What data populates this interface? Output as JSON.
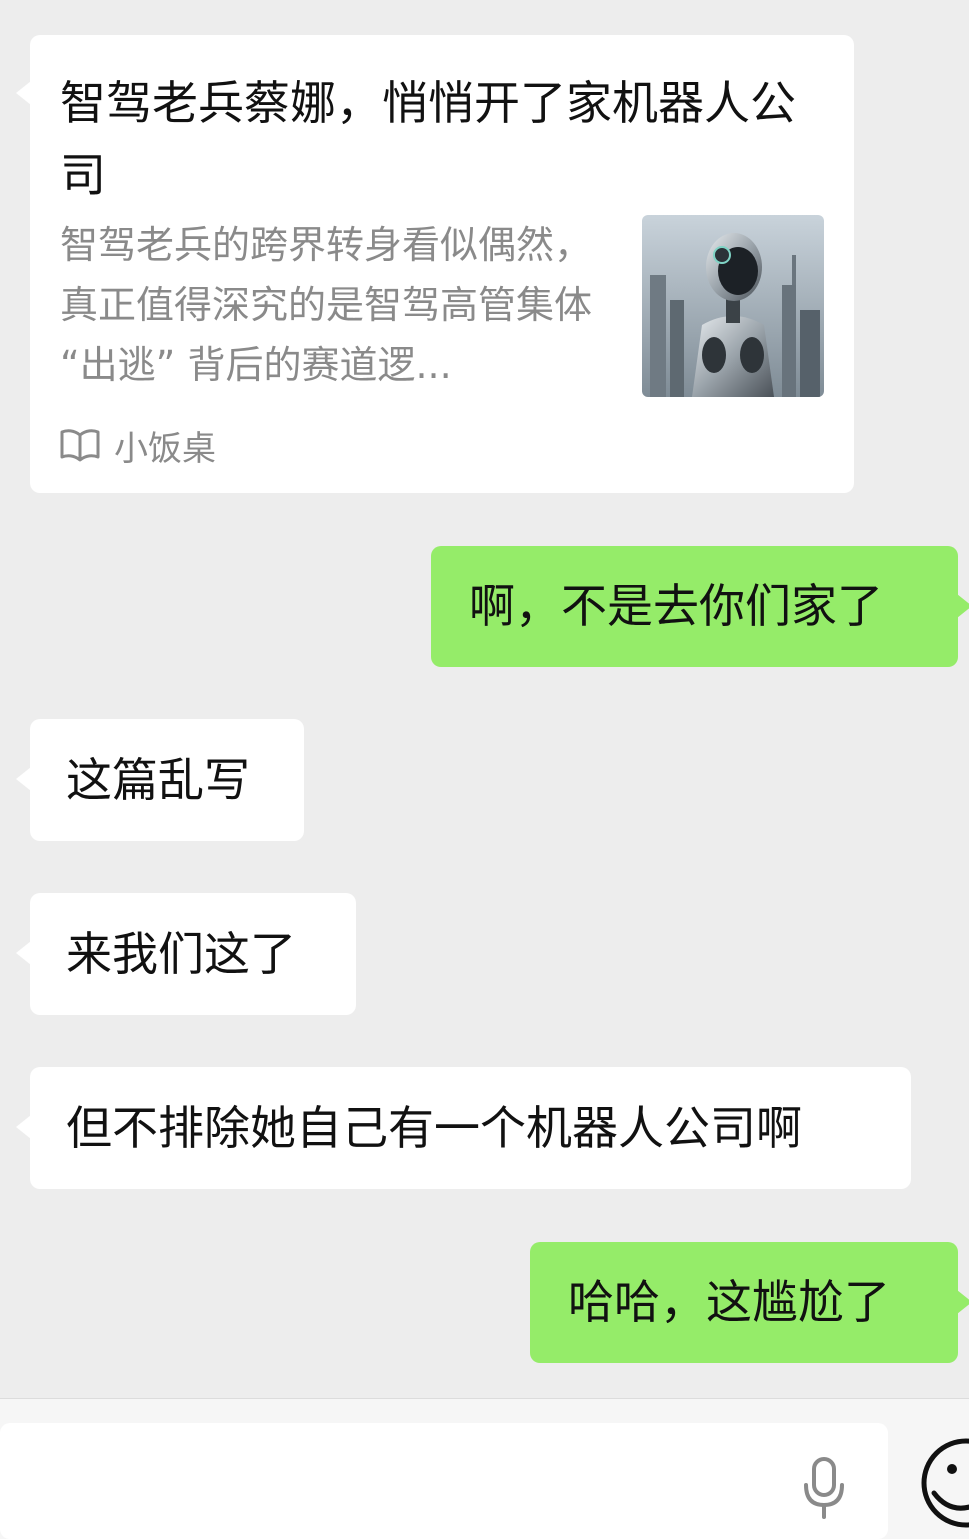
{
  "messages": {
    "card": {
      "title": "智驾老兵蔡娜，悄悄开了家机器人公司",
      "description": "智驾老兵的跨界转身看似偶然，真正值得深究的是智驾高管集体 “出逃” 背后的赛道逻...",
      "source": "小饭桌",
      "source_icon": "book-open-icon",
      "thumbnail": "robot-city-image"
    },
    "m1": "啊，不是去你们家了",
    "m2": "这篇乱写",
    "m3": "来我们这了",
    "m4": "但不排除她自己有一个机器人公司啊",
    "m5": "哈哈，这尴尬了"
  },
  "input": {
    "voice_icon": "microphone-icon",
    "emoji_icon": "emoji-icon"
  },
  "colors": {
    "background": "#ededed",
    "incoming_bubble": "#ffffff",
    "outgoing_bubble": "#95ec69",
    "secondary_text": "#8a8a8a"
  }
}
